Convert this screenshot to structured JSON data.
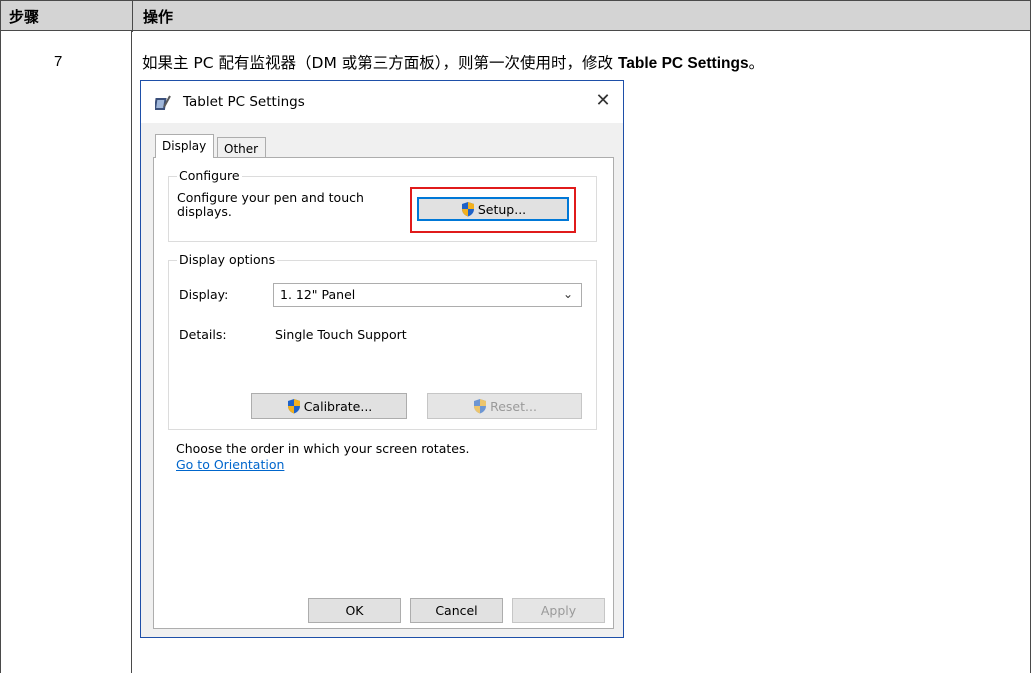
{
  "table": {
    "header": {
      "col1": "步骤",
      "col2": "操作"
    },
    "row": {
      "step": "7",
      "instruction_prefix": "如果主 PC 配有监视器（DM 或第三方面板），则第一次使用时，修改 ",
      "instruction_bold": "Table PC Settings",
      "instruction_suffix": "。"
    }
  },
  "dialog": {
    "title": "Tablet PC Settings",
    "close_glyph": "✕",
    "tabs": [
      {
        "label": "Display"
      },
      {
        "label": "Other"
      }
    ],
    "configure": {
      "group_label": "Configure",
      "description": "Configure your pen and touch displays.",
      "setup_button": "Setup..."
    },
    "display_options": {
      "group_label": "Display options",
      "display_label": "Display:",
      "display_value": "1. 12\" Panel",
      "details_label": "Details:",
      "details_value": "Single Touch Support",
      "calibrate_button": "Calibrate...",
      "reset_button": "Reset..."
    },
    "orientation_text": "Choose the order in which your screen rotates.",
    "orientation_link": "Go to Orientation",
    "footer": {
      "ok": "OK",
      "cancel": "Cancel",
      "apply": "Apply"
    }
  },
  "colors": {
    "highlight_box": "#e01b1b",
    "link": "#0066cc",
    "accent": "#0078d7"
  },
  "icons": {
    "app": "tablet-pen-icon",
    "shield": "uac-shield-icon",
    "chevron": "chevron-down-icon"
  }
}
